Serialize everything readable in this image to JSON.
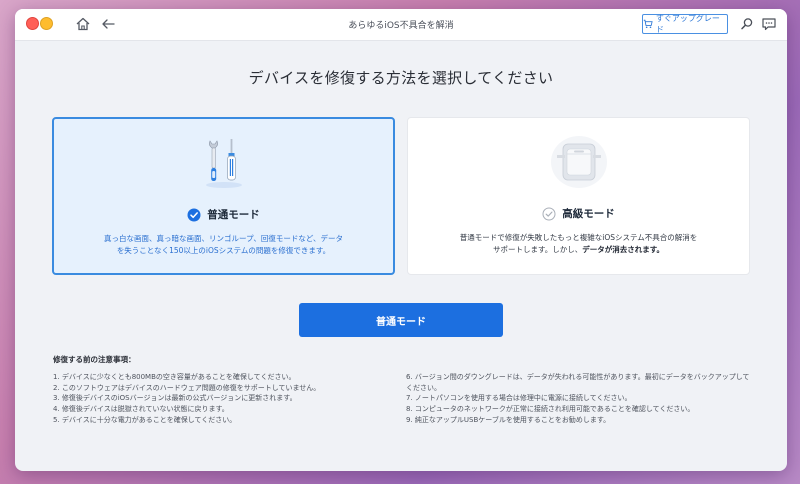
{
  "window": {
    "title": "あらゆるiOS不具合を解消",
    "upgrade_label": "すぐアップグレード"
  },
  "heading": "デバイスを修復する方法を選択してください",
  "modes": {
    "standard": {
      "title": "普通モード",
      "description_line1": "真っ白な画面、真っ暗な画面、リンゴループ、回復モードなど、データ",
      "description_line2": "を失うことなく150以上のiOSシステムの問題を修復できます。",
      "selected": true
    },
    "advanced": {
      "title": "高級モード",
      "description_line1": "普通モードで修復が失敗したもっと複雑なiOSシステム不具合の解消を",
      "description_line2a": "サポートします。しかし、",
      "description_line2b": "データが消去されます。",
      "selected": false
    }
  },
  "primary_button": "普通モード",
  "notes": {
    "title": "修復する前の注意事項：",
    "left": [
      "1. デバイスに少なくとも800MBの空き容量があることを確保してください。",
      "2. このソフトウェアはデバイスのハードウェア問題の修復をサポートしていません。",
      "3. 修復後デバイスのiOSバージョンは最新の公式バージョンに更新されます。",
      "4. 修復後デバイスは脱獄されていない状態に戻ります。",
      "5. デバイスに十分な電力があることを確保してください。"
    ],
    "right": [
      "6. バージョン間のダウングレードは、データが失われる可能性があります。最初にデータをバックアップしてください。",
      "7. ノートパソコンを使用する場合は修理中に電源に接続してください。",
      "8. コンピュータのネットワークが正常に接続され利用可能であることを確認してください。",
      "9. 純正なアップルUSBケーブルを使用することをお勧めします。"
    ]
  },
  "colors": {
    "accent": "#1c6fe0",
    "selected_card_bg": "#e6f1fd",
    "selected_border": "#3a8be0"
  }
}
